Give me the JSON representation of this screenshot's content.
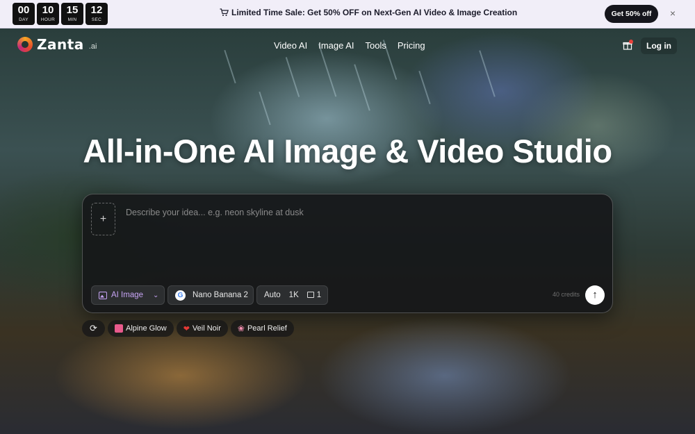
{
  "promo": {
    "timer": [
      {
        "value": "00",
        "unit": "DAY"
      },
      {
        "value": "10",
        "unit": "HOUR"
      },
      {
        "value": "15",
        "unit": "MIN"
      },
      {
        "value": "12",
        "unit": "SEC"
      }
    ],
    "message": "Limited Time Sale: Get 50% OFF on Next-Gen AI Video & Image Creation",
    "cta": "Get 50% off",
    "close": "×"
  },
  "brand": {
    "name": "Zanta",
    "suffix": ".ai"
  },
  "nav": {
    "items": [
      "Video AI",
      "Image AI",
      "Tools",
      "Pricing"
    ],
    "login": "Log in"
  },
  "hero": {
    "headline": "All-in-One AI Image & Video Studio"
  },
  "composer": {
    "placeholder": "Describe your idea... e.g. neon skyline at dusk",
    "add": "+",
    "type_label": "AI Image",
    "model_label": "Nano Banana 2",
    "ratio": "Auto",
    "resolution": "1K",
    "count": "1",
    "credits": "40 credits",
    "send": "↑"
  },
  "chips": {
    "refresh": "⟳",
    "items": [
      {
        "label": "Alpine Glow",
        "color": "#e85a8c"
      },
      {
        "label": "Veil Noir",
        "color": "#e53935"
      },
      {
        "label": "Pearl Relief",
        "color": "#f48fb1"
      }
    ]
  },
  "colors": {
    "accent": "#c7a4f5",
    "promo_bg": "#f1eef8",
    "dark": "#15151c"
  }
}
